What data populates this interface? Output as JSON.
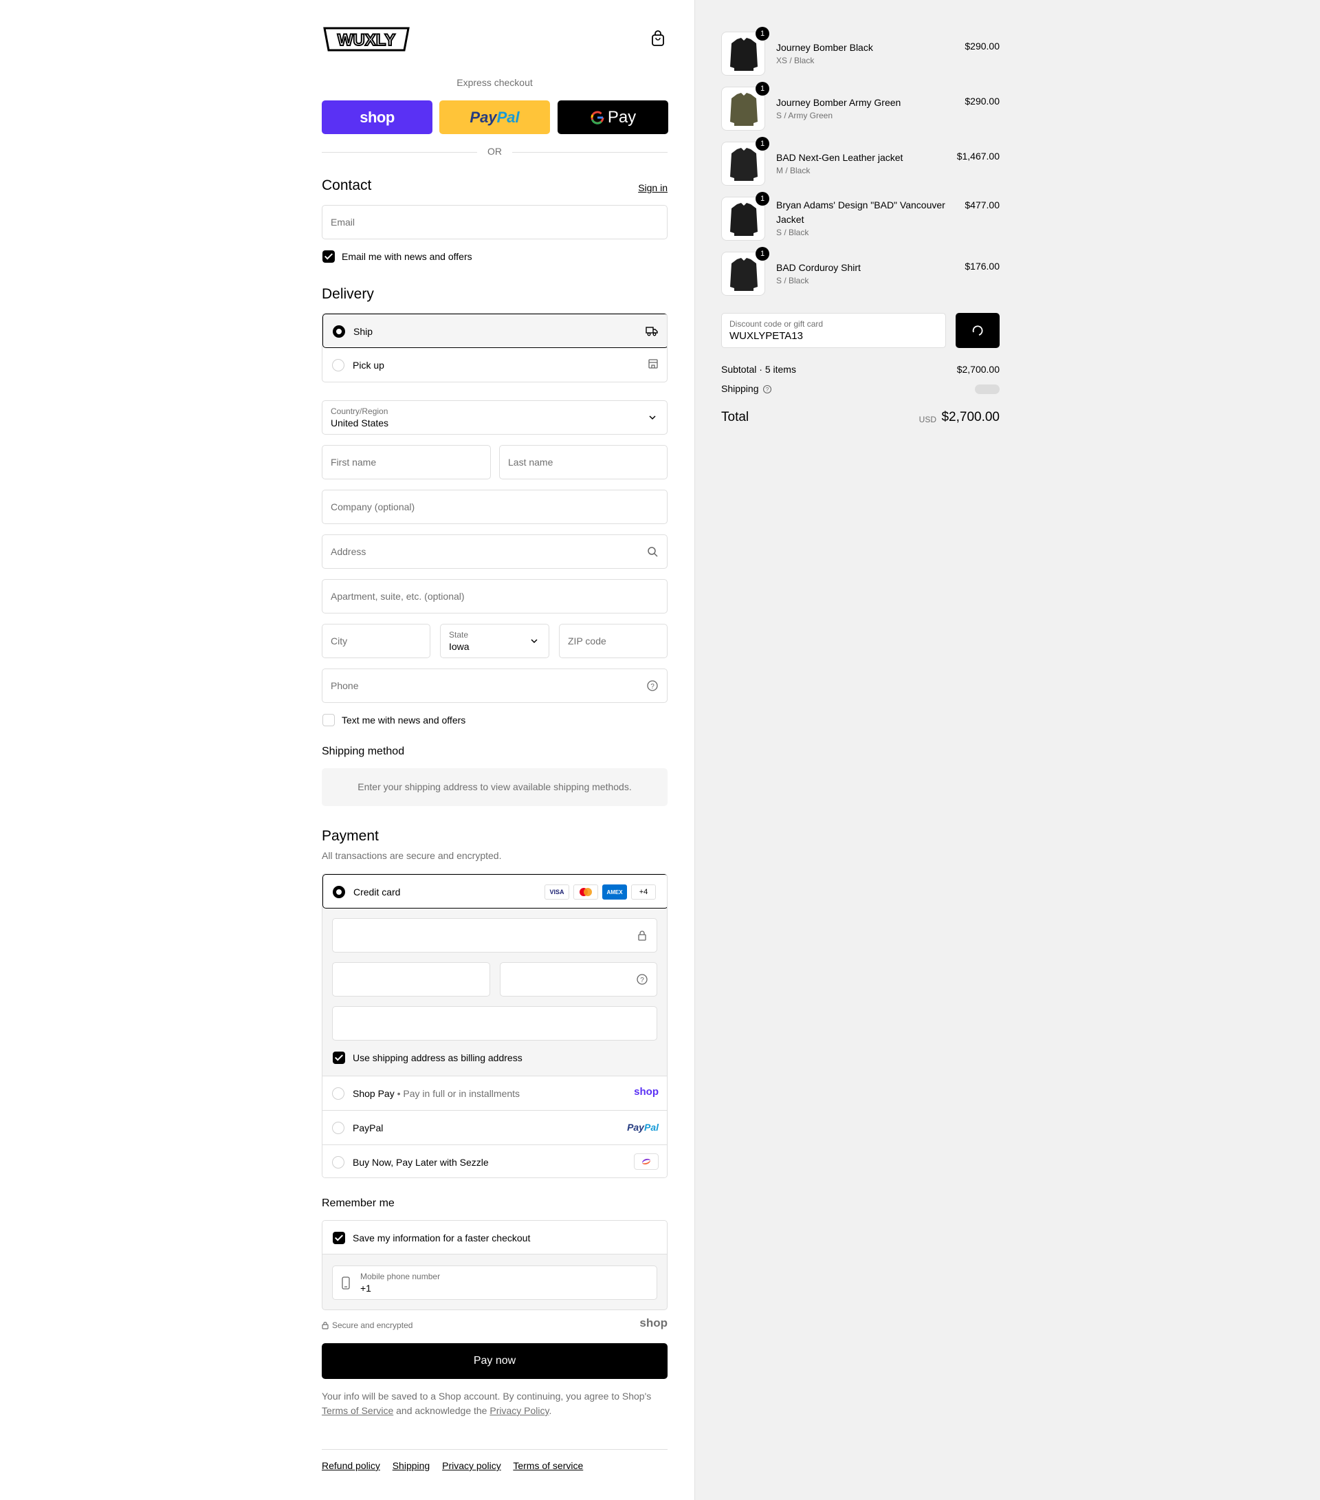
{
  "brand": {
    "logo_text": "WUXLY"
  },
  "express": {
    "label": "Express checkout",
    "shop_label": "shop",
    "paypal_dark": "Pay",
    "paypal_light": "Pal",
    "gpay_label": "Pay",
    "or_label": "OR"
  },
  "contact": {
    "title": "Contact",
    "signin": "Sign in",
    "email_placeholder": "Email",
    "news_label": "Email me with news and offers"
  },
  "delivery": {
    "title": "Delivery",
    "ship_label": "Ship",
    "pickup_label": "Pick up",
    "country_label": "Country/Region",
    "country_value": "United States",
    "first_name": "First name",
    "last_name": "Last name",
    "company": "Company (optional)",
    "address": "Address",
    "apartment": "Apartment, suite, etc. (optional)",
    "city": "City",
    "state_label": "State",
    "state_value": "Iowa",
    "zip": "ZIP code",
    "phone": "Phone",
    "text_news": "Text me with news and offers"
  },
  "shipping_method": {
    "title": "Shipping method",
    "message": "Enter your shipping address to view available shipping methods."
  },
  "payment": {
    "title": "Payment",
    "subtitle": "All transactions are secure and encrypted.",
    "credit_card": "Credit card",
    "card_logos": [
      "VISA",
      "MC",
      "AMEX",
      "+4"
    ],
    "billing_same": "Use shipping address as billing address",
    "shop_pay": "Shop Pay",
    "shop_pay_sub": "Pay in full or in installments",
    "shop_pay_logo": "shop",
    "paypal": "PayPal",
    "sezzle": "Buy Now, Pay Later with Sezzle"
  },
  "remember": {
    "title": "Remember me",
    "save_label": "Save my information for a faster checkout",
    "mobile_label": "Mobile phone number",
    "mobile_value": "+1",
    "secure_label": "Secure and encrypted",
    "shop_logo": "shop"
  },
  "pay_now": "Pay now",
  "legal": {
    "line1": "Your info will be saved to a Shop account. By continuing, you agree to Shop's",
    "tos": "Terms of Service",
    "mid": "and acknowledge the",
    "privacy": "Privacy Policy",
    "end": "."
  },
  "footer": [
    "Refund policy",
    "Shipping",
    "Privacy policy",
    "Terms of service"
  ],
  "cart": {
    "items": [
      {
        "name": "Journey Bomber Black",
        "variant": "XS / Black",
        "price": "$290.00",
        "qty": "1",
        "color": "#1a1a1a"
      },
      {
        "name": "Journey Bomber Army Green",
        "variant": "S / Army Green",
        "price": "$290.00",
        "qty": "1",
        "color": "#5b5a3c"
      },
      {
        "name": "BAD Next-Gen Leather jacket",
        "variant": "M / Black",
        "price": "$1,467.00",
        "qty": "1",
        "color": "#222222"
      },
      {
        "name": "Bryan Adams' Design \"BAD\" Vancouver Jacket",
        "variant": "S / Black",
        "price": "$477.00",
        "qty": "1",
        "color": "#1c1c1c"
      },
      {
        "name": "BAD Corduroy Shirt",
        "variant": "S / Black",
        "price": "$176.00",
        "qty": "1",
        "color": "#202020"
      }
    ],
    "discount_label": "Discount code or gift card",
    "discount_value": "WUXLYPETA13",
    "subtotal_label": "Subtotal · 5 items",
    "subtotal_value": "$2,700.00",
    "shipping_label": "Shipping",
    "total_label": "Total",
    "currency": "USD",
    "total_value": "$2,700.00"
  }
}
